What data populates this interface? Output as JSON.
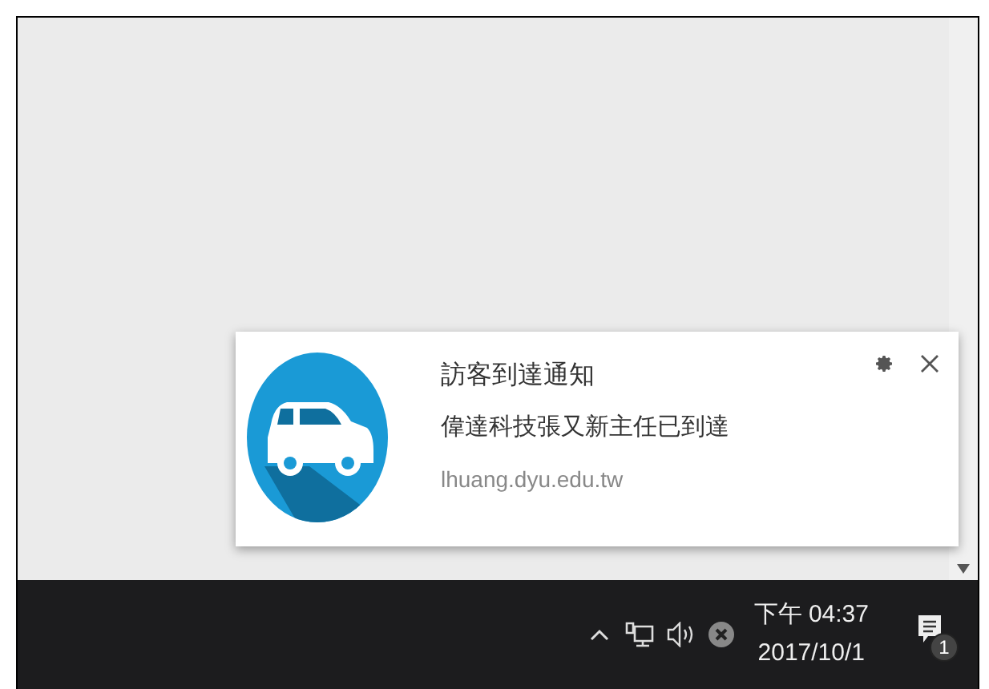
{
  "notification": {
    "title": "訪客到達通知",
    "message": "偉達科技張又新主任已到達",
    "source": "lhuang.dyu.edu.tw"
  },
  "taskbar": {
    "time": "下午 04:37",
    "date": "2017/10/1",
    "notification_count": "1"
  }
}
